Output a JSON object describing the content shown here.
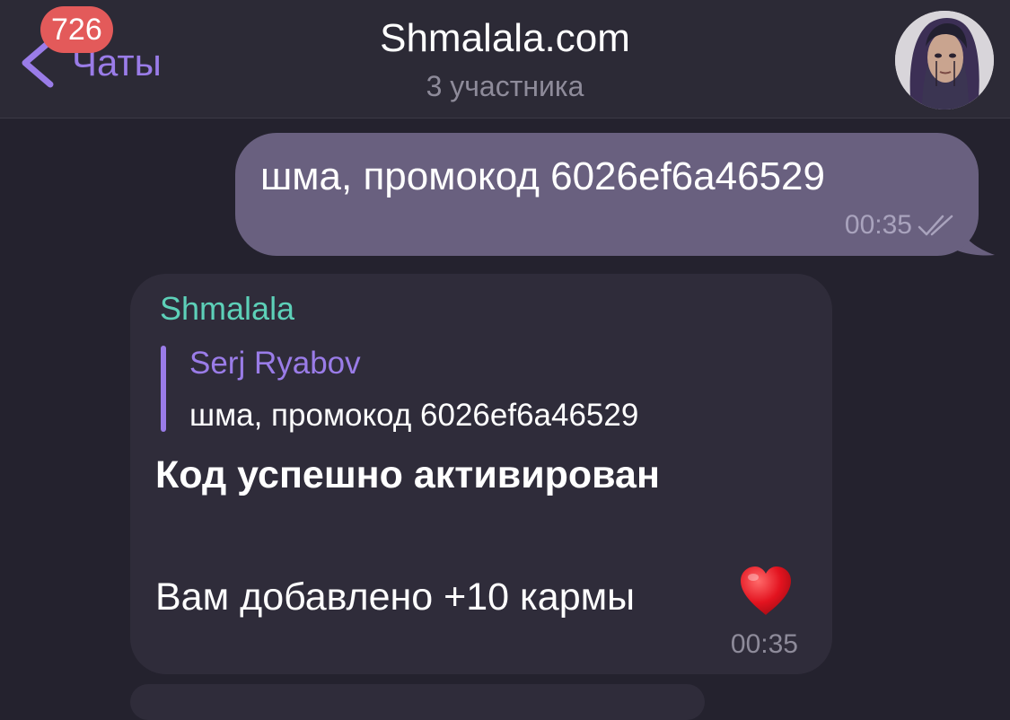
{
  "header": {
    "back_label": "Чаты",
    "unread_count": "726",
    "title": "Shmalala.com",
    "subtitle": "3 участника",
    "avatar_icon": "user-avatar"
  },
  "messages": {
    "outgoing": {
      "text": "шма, промокод 6026ef6a46529",
      "time": "00:35",
      "status_icon": "double-check-icon"
    },
    "incoming": {
      "sender": "Shmalala",
      "reply": {
        "author": "Serj Ryabov",
        "text": "шма, промокод 6026ef6a46529"
      },
      "line_bold": "Код успешно активирован",
      "line_regular": "Вам добавлено +10 кармы",
      "emoji_icon": "heart-icon",
      "time": "00:35"
    }
  },
  "colors": {
    "background": "#24222e",
    "header": "#2c2a36",
    "accent": "#9a7ce8",
    "outgoing_bubble": "#69607f",
    "incoming_bubble": "#2f2c3a",
    "sender_name": "#5dd0b8",
    "badge": "#e35a5a"
  }
}
